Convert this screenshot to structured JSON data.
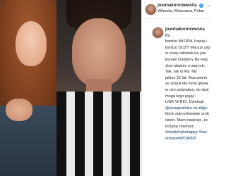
{
  "post": {
    "username": "joannakoroniewska",
    "location": "Wilanów, Warszawa, Polan",
    "verified_mark": "✓",
    "more_mark": "···"
  },
  "caption": {
    "username": "joannakoroniewska",
    "lines": [
      "Ba",
      "bardzo MŁODA Joasia i",
      "bardzo DUŻY Maciuś zap",
      "w nowy odcinek na you",
      "kanale Dowbory Be Hap",
      "Jest właśnie o starych..",
      "Tak, tak to My. My",
      "jakieś 25 lat. Rozumiem",
      "ze stracił dla mnie głowę",
      "w nim widziałam, do dziś",
      "mogę tego pojąć.",
      "LINK W BIO. Dziękuje",
      "@annapralinka za zdjęc",
      "które zdecydowanie zrob",
      "dzień. Mam nadzieje, że",
      "troszkę rówinież.",
      "#dowborybehappy #low",
      "#czasemPOWER"
    ]
  }
}
